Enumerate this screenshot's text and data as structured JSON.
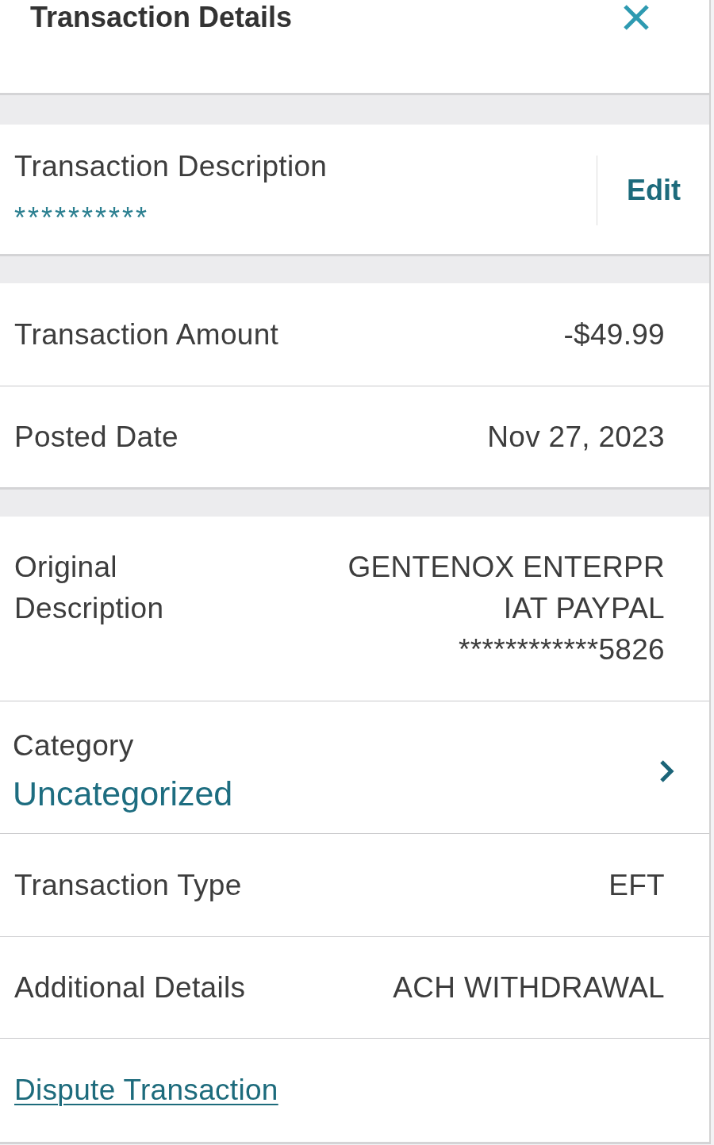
{
  "header": {
    "title": "Transaction Details"
  },
  "description_card": {
    "label": "Transaction Description",
    "value": "**********",
    "edit_button": "Edit"
  },
  "summary_card": {
    "rows": [
      {
        "label": "Transaction Amount",
        "value": "-$49.99"
      },
      {
        "label": "Posted Date",
        "value": "Nov 27, 2023"
      }
    ]
  },
  "details_card": {
    "rows": [
      {
        "kind": "multiline",
        "label": "Original Description",
        "lines": [
          "GENTENOX ENTERPR",
          "IAT PAYPAL",
          "************5826"
        ]
      },
      {
        "kind": "link",
        "label": "Category",
        "value": "Uncategorized"
      },
      {
        "kind": "plain",
        "label": "Transaction Type",
        "value": "EFT"
      },
      {
        "kind": "plain",
        "label": "Additional Details",
        "value": "ACH WITHDRAWAL"
      },
      {
        "kind": "action",
        "link": "Dispute Transaction"
      }
    ]
  }
}
